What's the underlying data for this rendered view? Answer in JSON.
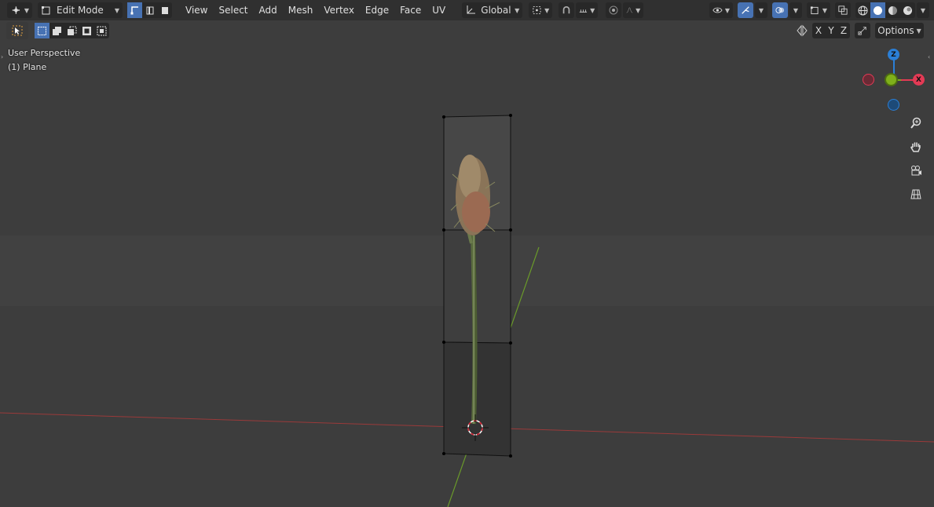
{
  "header": {
    "mode_label": "Edit Mode",
    "menus": [
      "View",
      "Select",
      "Add",
      "Mesh",
      "Vertex",
      "Edge",
      "Face",
      "UV"
    ],
    "orientation_label": "Global"
  },
  "tool_header": {
    "axis_x": "X",
    "axis_y": "Y",
    "axis_z": "Z",
    "options_label": "Options"
  },
  "overlay": {
    "view_name": "User Perspective",
    "object_name": "(1) Plane"
  },
  "gizmo": {
    "z_label": "Z",
    "x_label": "X"
  },
  "icons": [
    "editor-type-icon",
    "edit-mode-icon",
    "vertex-select-icon",
    "edge-select-icon",
    "face-select-icon",
    "transform-orientation-icon",
    "pivot-icon",
    "snap-icon",
    "snap-increment-icon",
    "proportional-edit-icon",
    "falloff-icon",
    "visibility-icon",
    "gizmo-icon",
    "overlay-icon",
    "xray-icon",
    "wireframe-shading-icon",
    "solid-shading-icon",
    "material-shading-icon",
    "rendered-shading-icon",
    "select-box-icon",
    "mirror-icon",
    "auto-merge-icon",
    "zoom-icon",
    "hand-icon",
    "camera-icon",
    "ortho-grid-icon"
  ],
  "colors": {
    "header_bg": "#303030",
    "viewport_bg": "#3d3d3d",
    "active_blue": "#4772b3",
    "axis_x": "#e33a55",
    "axis_y": "#7fb01a",
    "axis_z": "#2b7fd6"
  }
}
